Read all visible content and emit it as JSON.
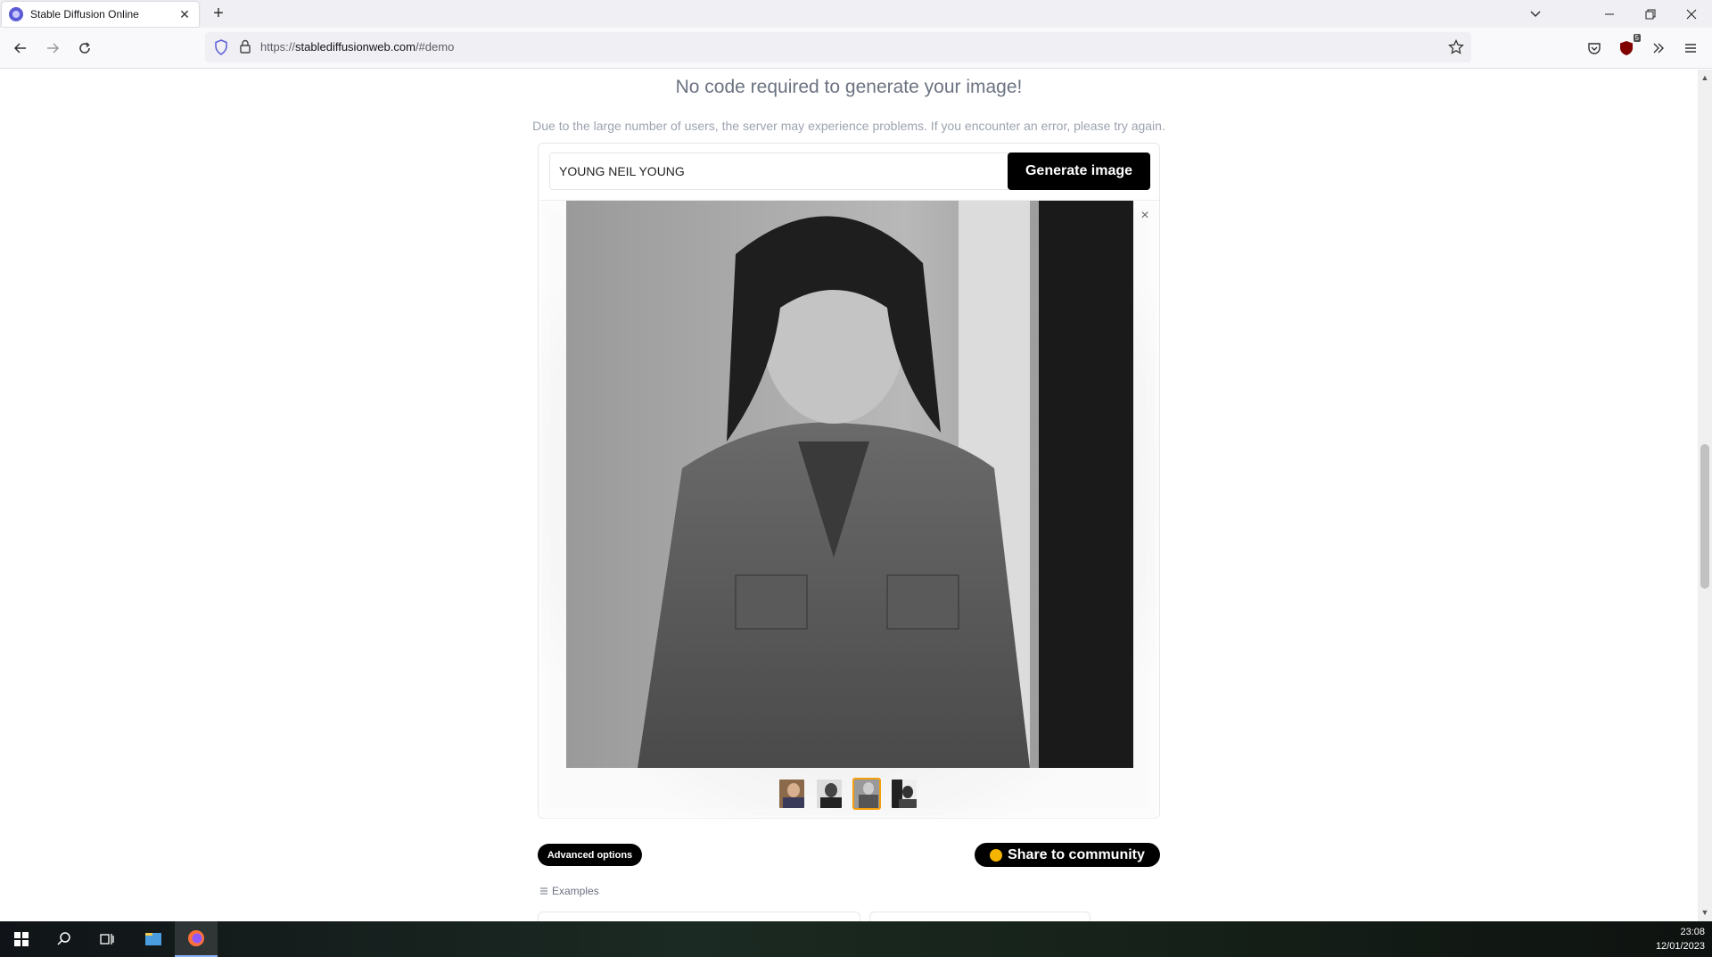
{
  "browser": {
    "tab_title": "Stable Diffusion Online",
    "url_prefix": "https://",
    "url_host": "stablediffusionweb.com",
    "url_path": "/#demo",
    "extension_badge": "5"
  },
  "page": {
    "headline": "No code required to generate your image!",
    "notice": "Due to the large number of users, the server may experience problems. If you encounter an error, please try again.",
    "prompt_value": "YOUNG NEIL YOUNG",
    "generate_label": "Generate image",
    "close_label": "×",
    "advanced_label": "Advanced options",
    "share_label": "Share to community",
    "examples_label": "Examples"
  },
  "taskbar": {
    "time": "23:08",
    "date": "12/01/2023"
  },
  "colors": {
    "accent": "#000000",
    "selected_thumb": "#f59e0b"
  }
}
